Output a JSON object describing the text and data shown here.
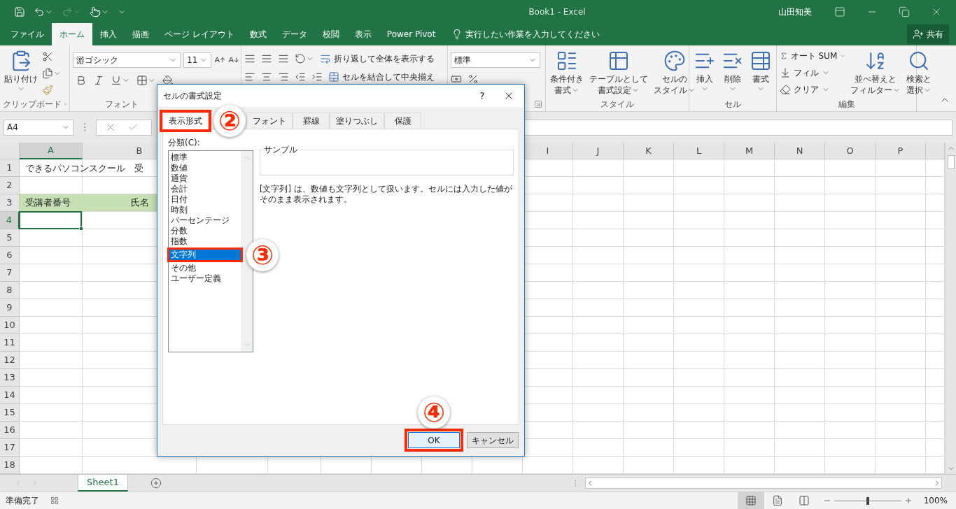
{
  "title_bar": {
    "title": "Book1 - Excel",
    "user": "山田知美"
  },
  "ribbon_tabs": [
    {
      "label": "ファイル",
      "selected": false
    },
    {
      "label": "ホーム",
      "selected": true
    },
    {
      "label": "挿入",
      "selected": false
    },
    {
      "label": "描画",
      "selected": false
    },
    {
      "label": "ページ レイアウト",
      "selected": false
    },
    {
      "label": "数式",
      "selected": false
    },
    {
      "label": "データ",
      "selected": false
    },
    {
      "label": "校閲",
      "selected": false
    },
    {
      "label": "表示",
      "selected": false
    },
    {
      "label": "Power Pivot",
      "selected": false
    }
  ],
  "tell_me": {
    "placeholder": "実行したい作業を入力してください"
  },
  "share_button": "共有",
  "ribbon": {
    "clipboard": {
      "paste": "貼り付け",
      "label": "クリップボード"
    },
    "font": {
      "font_name": "游ゴシック",
      "font_size": "11",
      "label": "フォント"
    },
    "alignment": {
      "wrap_text": "折り返して全体を表示する",
      "merge_center": "セルを結合して中央揃え"
    },
    "number": {
      "format": "標準"
    },
    "styles": {
      "buttons": [
        {
          "lines": [
            "条件付き",
            "書式"
          ]
        },
        {
          "lines": [
            "テーブルとして",
            "書式設定"
          ]
        },
        {
          "lines": [
            "セルの",
            "スタイル"
          ]
        }
      ],
      "label": "スタイル"
    },
    "cells": {
      "buttons": [
        "挿入",
        "削除",
        "書式"
      ],
      "label": "セル"
    },
    "editing": {
      "small": [
        "オート SUM",
        "フィル",
        "クリア"
      ],
      "large": [
        {
          "lines": [
            "並べ替えと",
            "フィルター"
          ]
        },
        {
          "lines": [
            "検索と",
            "選択"
          ]
        }
      ],
      "label": "編集"
    }
  },
  "formula_bar": {
    "name_box": "A4"
  },
  "sheet": {
    "columns": [
      {
        "label": "A",
        "selected": true
      },
      {
        "label": "B",
        "selected": false
      },
      {
        "label": "I",
        "selected": false
      },
      {
        "label": "J",
        "selected": false
      },
      {
        "label": "K",
        "selected": false
      },
      {
        "label": "L",
        "selected": false
      },
      {
        "label": "M",
        "selected": false
      },
      {
        "label": "N",
        "selected": false
      },
      {
        "label": "O",
        "selected": false
      },
      {
        "label": "P",
        "selected": false
      }
    ],
    "rows": [
      {
        "label": "1",
        "selected": false,
        "filled": false,
        "cells": [
          {
            "text": "できるパソコンスクール　受"
          }
        ]
      },
      {
        "label": "2",
        "selected": false,
        "filled": false
      },
      {
        "label": "3",
        "selected": false,
        "filled": true,
        "cells": [
          {
            "text": "受講者番号",
            "centered": false
          },
          {
            "text": "氏名",
            "centered": true
          }
        ]
      },
      {
        "label": "4",
        "selected": true,
        "filled": false
      },
      {
        "label": "5",
        "selected": false,
        "filled": false
      },
      {
        "label": "6",
        "selected": false,
        "filled": false
      },
      {
        "label": "7",
        "selected": false,
        "filled": false
      },
      {
        "label": "8",
        "selected": false,
        "filled": false
      },
      {
        "label": "9",
        "selected": false,
        "filled": false
      },
      {
        "label": "10",
        "selected": false,
        "filled": false
      },
      {
        "label": "11",
        "selected": false,
        "filled": false
      },
      {
        "label": "12",
        "selected": false,
        "filled": false
      },
      {
        "label": "13",
        "selected": false,
        "filled": false
      },
      {
        "label": "14",
        "selected": false,
        "filled": false
      },
      {
        "label": "15",
        "selected": false,
        "filled": false
      },
      {
        "label": "16",
        "selected": false,
        "filled": false
      },
      {
        "label": "17",
        "selected": false,
        "filled": false
      },
      {
        "label": "18",
        "selected": false,
        "filled": false
      }
    ],
    "sheet_tabs": [
      {
        "label": "Sheet1",
        "selected": true
      }
    ]
  },
  "status_bar": {
    "text": "準備完了",
    "view_buttons": [
      {
        "kind": "normal",
        "selected": true
      },
      {
        "kind": "page_layout",
        "selected": false
      },
      {
        "kind": "page_break",
        "selected": false
      }
    ],
    "zoom": {
      "level": 0.5,
      "reading": "100%"
    }
  },
  "dialog": {
    "title": "セルの書式設定",
    "help": "?",
    "tabs": [
      {
        "label": "表示形式",
        "selected": true,
        "annotation": "②"
      },
      {
        "label": "フォント",
        "selected": false
      },
      {
        "label": "罫線",
        "selected": false
      },
      {
        "label": "塗りつぶし",
        "selected": false
      },
      {
        "label": "保護",
        "selected": false
      }
    ],
    "category_label": "分類(C):",
    "categories": [
      {
        "label": "標準",
        "selected": false
      },
      {
        "label": "数値",
        "selected": false
      },
      {
        "label": "通貨",
        "selected": false
      },
      {
        "label": "会計",
        "selected": false
      },
      {
        "label": "日付",
        "selected": false
      },
      {
        "label": "時刻",
        "selected": false
      },
      {
        "label": "パーセンテージ",
        "selected": false
      },
      {
        "label": "分数",
        "selected": false
      },
      {
        "label": "指数",
        "selected": false
      },
      {
        "label": "文字列",
        "selected": true,
        "annotation": "③"
      },
      {
        "label": "その他",
        "selected": false
      },
      {
        "label": "ユーザー定義",
        "selected": false
      }
    ],
    "sample_label": "サンプル",
    "description": "[文字列] は、数値も文字列として扱います。セルには入力した値がそのまま表示されます。",
    "buttons": [
      {
        "label": "OK",
        "kind": "primary",
        "annotation": "④"
      },
      {
        "label": "キャンセル",
        "kind": "secondary"
      }
    ]
  }
}
